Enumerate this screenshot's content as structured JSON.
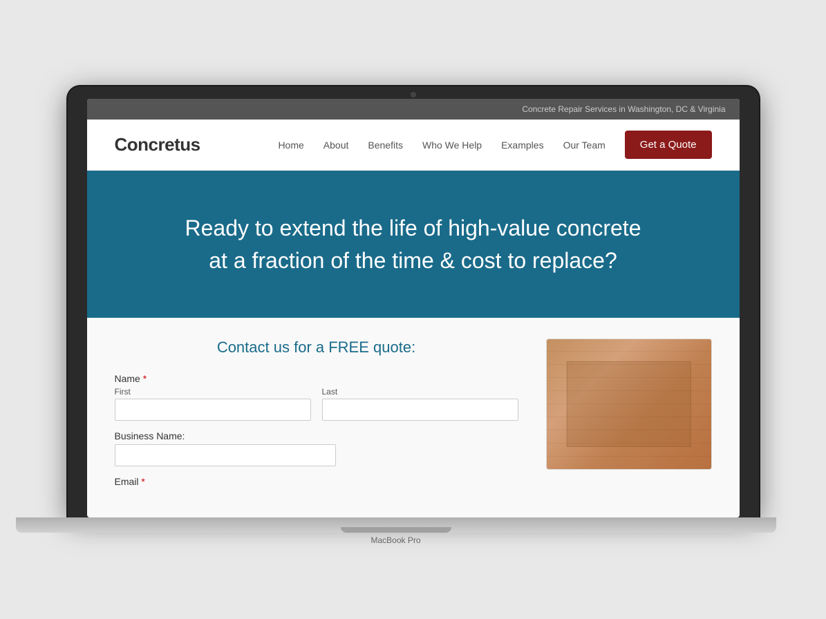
{
  "macbook": {
    "label": "MacBook Pro"
  },
  "site": {
    "topbar": {
      "text": "Concrete Repair Services in Washington, DC & Virginia"
    },
    "logo": {
      "prefix": "Concret",
      "suffix": "us"
    },
    "nav": {
      "items": [
        {
          "label": "Home",
          "href": "#"
        },
        {
          "label": "About",
          "href": "#"
        },
        {
          "label": "Benefits",
          "href": "#"
        },
        {
          "label": "Who We Help",
          "href": "#"
        },
        {
          "label": "Examples",
          "href": "#"
        },
        {
          "label": "Our Team",
          "href": "#"
        }
      ],
      "cta": "Get a Quote"
    },
    "hero": {
      "headline_line1": "Ready to extend the life of high-value concrete",
      "headline_line2": "at a fraction of the time & cost to replace?"
    },
    "form": {
      "section_title": "Contact us for a FREE quote:",
      "name_label": "Name",
      "first_label": "First",
      "last_label": "Last",
      "business_label": "Business Name:",
      "email_label": "Email",
      "required_marker": "*"
    }
  }
}
